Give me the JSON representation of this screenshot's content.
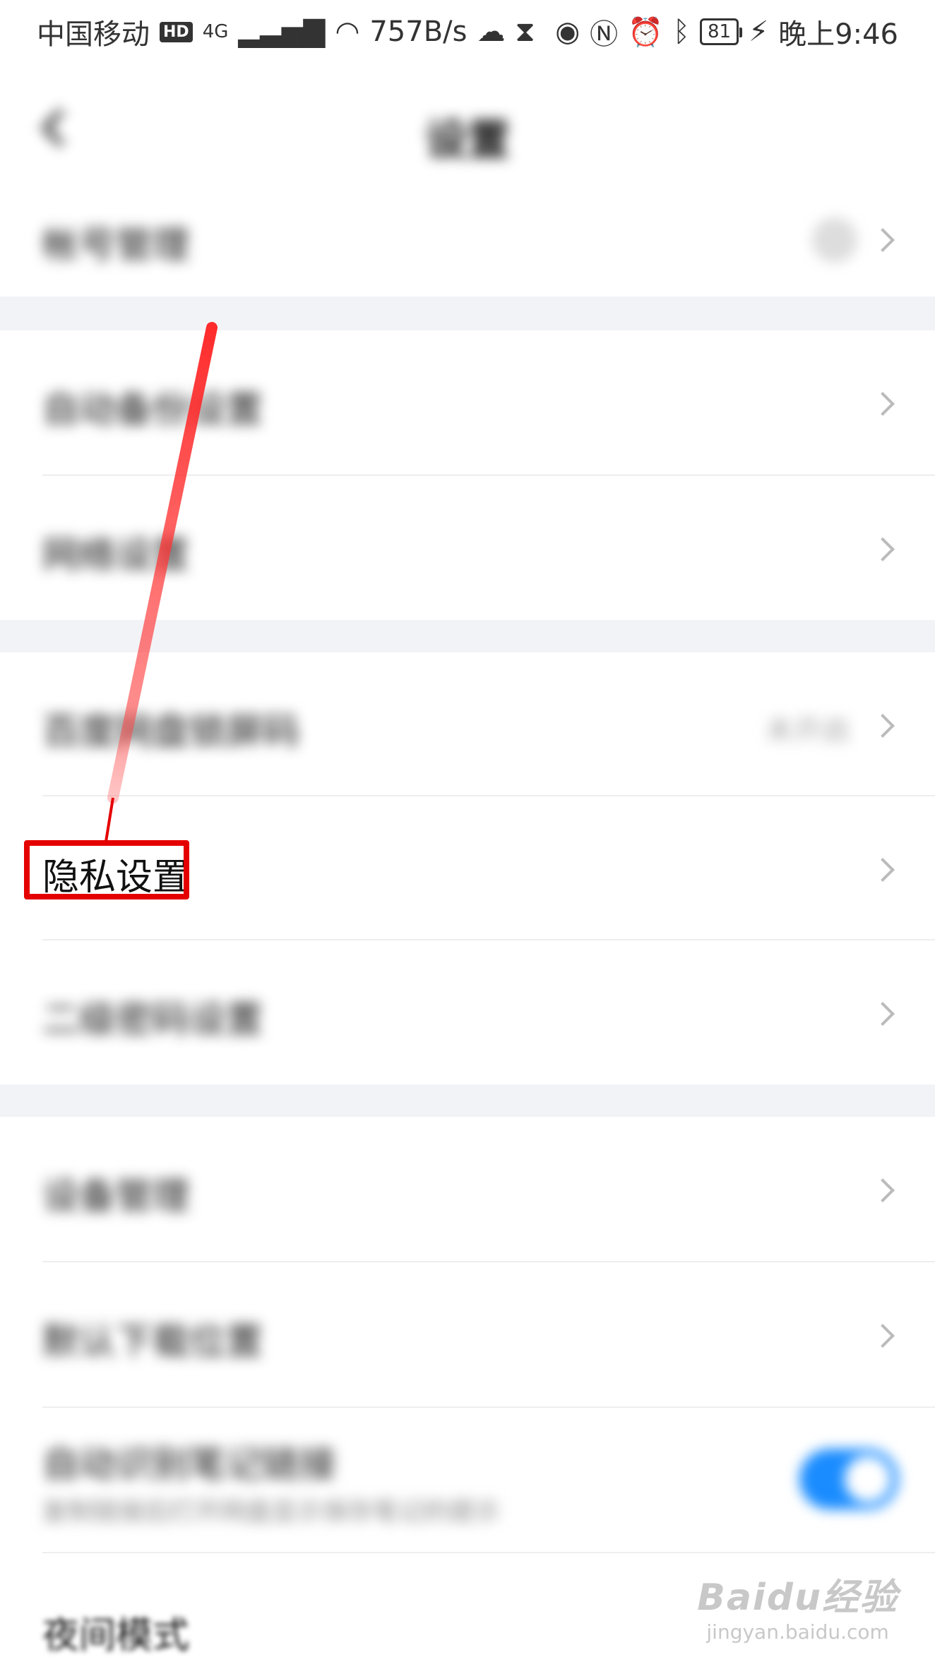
{
  "status_bar": {
    "carrier": "中国移动",
    "hd": "HD",
    "network": "4G",
    "speed": "757B/s",
    "battery": "81",
    "time": "晚上9:46"
  },
  "header": {
    "title": "设置"
  },
  "settings": [
    {
      "label": "帐号管理"
    },
    {
      "label": "自动备份设置"
    },
    {
      "label": "网络设置"
    },
    {
      "label": "百度网盘锁屏码",
      "value": "未开启"
    },
    {
      "label": "隐私设置"
    },
    {
      "label": "二级密码设置"
    },
    {
      "label": "设备管理"
    },
    {
      "label": "默认下载位置"
    },
    {
      "label": "自动识别笔记链接",
      "sub": "复制链接后打开网盘显示保存笔记的提示",
      "toggle_on": true
    },
    {
      "label": "夜间模式"
    }
  ],
  "watermark": {
    "brand": "Baidu经验",
    "url": "jingyan.baidu.com"
  },
  "colors": {
    "highlight": "#e50000",
    "toggle_on": "#1a8cff"
  }
}
